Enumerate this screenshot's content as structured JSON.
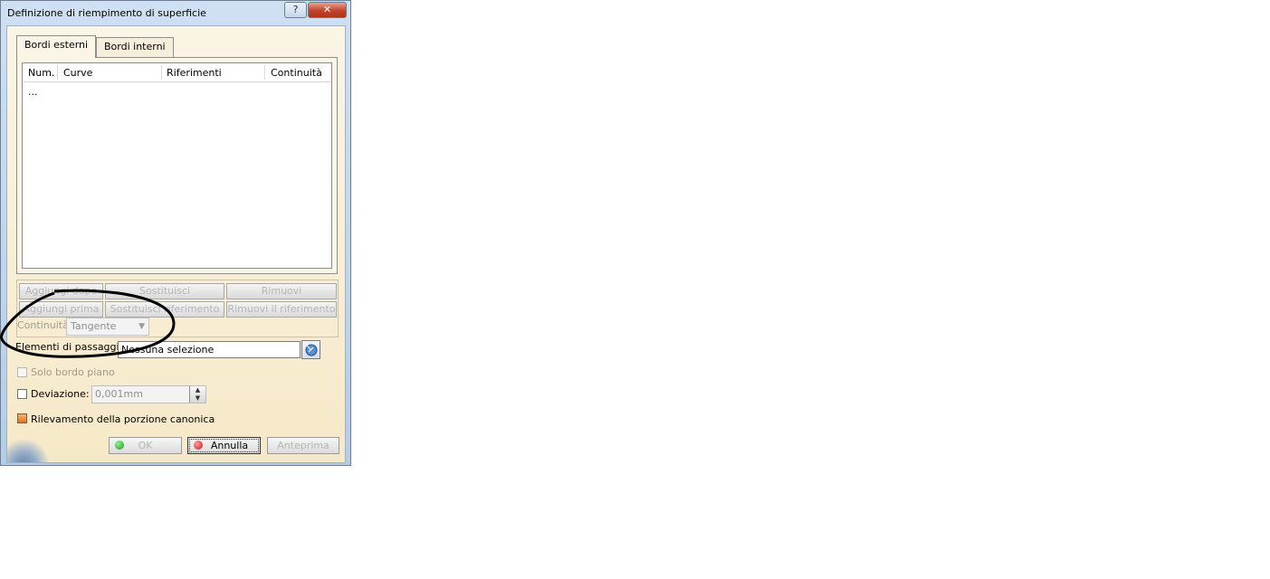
{
  "window": {
    "title": "Definizione di riempimento di superficie",
    "help_label": "?",
    "close_label": "✕"
  },
  "tabs": [
    {
      "label": "Bordi esterni",
      "active": true
    },
    {
      "label": "Bordi interni",
      "active": false
    }
  ],
  "table": {
    "columns": [
      "Num.",
      "Curve",
      "Riferimenti",
      "Continuità"
    ],
    "rows": [
      [
        "..."
      ]
    ]
  },
  "actions": {
    "aggiungi_dopo": "Aggiungi dopo",
    "sostituisci": "Sostituisci",
    "rimuovi": "Rimuovi",
    "aggiungi_prima": "Aggiungi prima",
    "sostituisci_riferimento": "Sostituisci riferimento",
    "rimuovi_riferimento": "Rimuovi il riferimento"
  },
  "continuita": {
    "label": "Continuità:",
    "value": "Tangente"
  },
  "passaggio": {
    "label": "Elementi di passaggio:",
    "value": "Nessuna selezione"
  },
  "options": {
    "solo_bordo_piano": {
      "label": "Solo bordo piano",
      "checked": false,
      "enabled": false
    },
    "deviazione": {
      "label": "Deviazione:",
      "checked": false,
      "value": "0,001mm"
    },
    "rilevamento": {
      "label": "Rilevamento della porzione canonica",
      "checked": true
    }
  },
  "footer": {
    "ok": "OK",
    "annulla": "Annulla",
    "anteprima": "Anteprima"
  },
  "colors": {
    "dialog_bg": "#f6e9c8",
    "annotation": "#000000"
  }
}
